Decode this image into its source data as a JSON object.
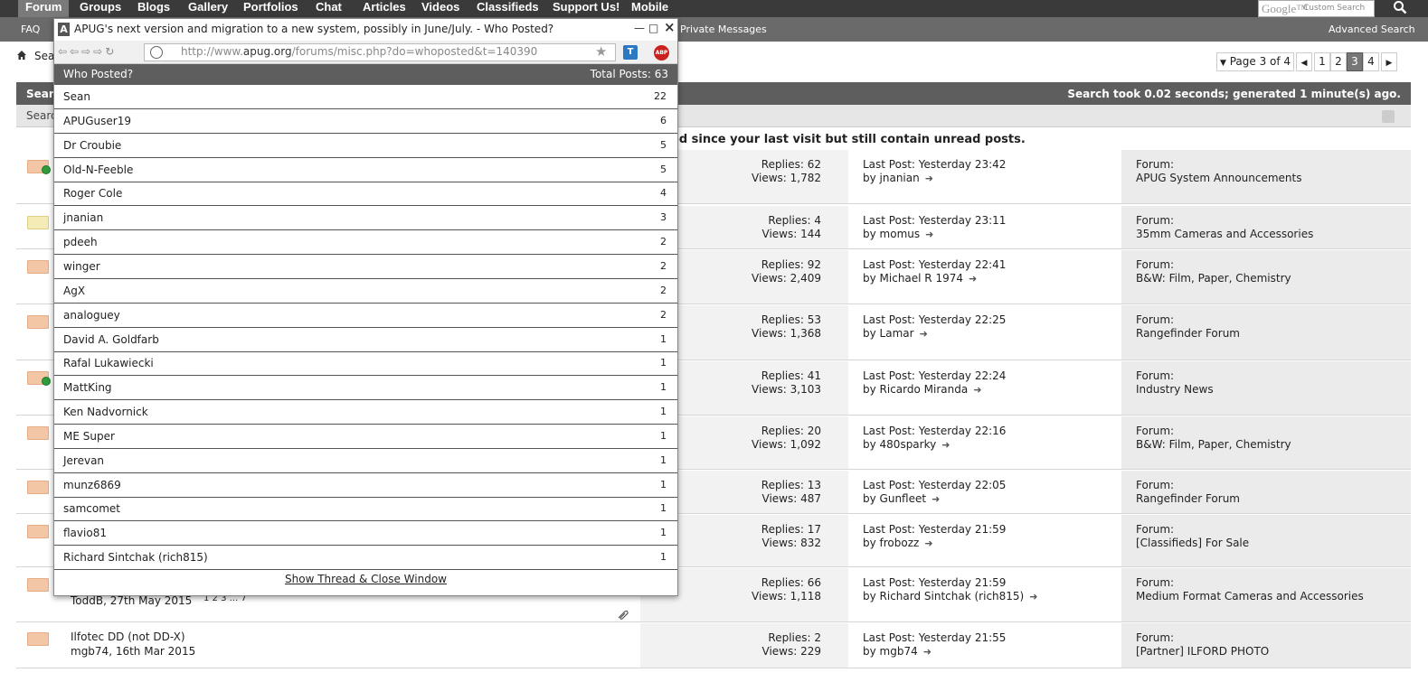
{
  "nav": {
    "items": [
      "Forum",
      "Groups",
      "Blogs",
      "Gallery",
      "Portfolios",
      "Chat",
      "Articles",
      "Videos",
      "Classifieds",
      "Support Us!",
      "Mobile"
    ],
    "search_brand": "Google™",
    "search_placeholder": "Custom Search"
  },
  "subnav": {
    "faq": "FAQ",
    "private_messages": "Private Messages",
    "advanced_search": "Advanced Search"
  },
  "breadcrumb": {
    "text": "Sea"
  },
  "pager": {
    "label": "Page 3 of 4",
    "pages": [
      "1",
      "2",
      "3",
      "4"
    ],
    "current": "3"
  },
  "results": {
    "left": "Searc",
    "right": "Search took 0.02 seconds; generated 1 minute(s) ago.",
    "filter": "Searc",
    "notice": "ed since your last visit but still contain unread posts."
  },
  "threads": [
    {
      "replies": "Replies: 62",
      "views": "Views: 1,782",
      "last": "Last Post: Yesterday 23:42",
      "by": "by jnanian",
      "forum_label": "Forum:",
      "forum": "APUG System Announcements",
      "icon": "unread",
      "go": true
    },
    {
      "replies": "Replies: 4",
      "views": "Views: 144",
      "last": "Last Post: Yesterday 23:11",
      "by": "by momus",
      "forum_label": "Forum:",
      "forum": "35mm Cameras and Accessories",
      "icon": "read",
      "go": false
    },
    {
      "replies": "Replies: 92",
      "views": "Views: 2,409",
      "last": "Last Post: Yesterday 22:41",
      "by": "by Michael R 1974",
      "forum_label": "Forum:",
      "forum": "B&W: Film, Paper, Chemistry",
      "icon": "unread",
      "go": false
    },
    {
      "replies": "Replies: 53",
      "views": "Views: 1,368",
      "last": "Last Post: Yesterday 22:25",
      "by": "by Lamar",
      "forum_label": "Forum:",
      "forum": "Rangefinder Forum",
      "icon": "unread",
      "go": false
    },
    {
      "replies": "Replies: 41",
      "views": "Views: 3,103",
      "last": "Last Post: Yesterday 22:24",
      "by": "by Ricardo Miranda",
      "forum_label": "Forum:",
      "forum": "Industry News",
      "icon": "unread",
      "go": true
    },
    {
      "replies": "Replies: 20",
      "views": "Views: 1,092",
      "last": "Last Post: Yesterday 22:16",
      "by": "by 480sparky",
      "forum_label": "Forum:",
      "forum": "B&W: Film, Paper, Chemistry",
      "icon": "unread",
      "go": false
    },
    {
      "replies": "Replies: 13",
      "views": "Views: 487",
      "last": "Last Post: Yesterday 22:05",
      "by": "by Gunfleet",
      "forum_label": "Forum:",
      "forum": "Rangefinder Forum",
      "icon": "unread",
      "go": false
    },
    {
      "replies": "Replies: 17",
      "views": "Views: 832",
      "last": "Last Post: Yesterday 21:59",
      "by": "by frobozz",
      "forum_label": "Forum:",
      "forum": "[Classifieds] For Sale",
      "icon": "unread",
      "go": false
    },
    {
      "replies": "Replies: 66",
      "views": "Views: 1,118",
      "last": "Last Post: Yesterday 21:59",
      "by": "by Richard Sintchak (rich815)",
      "forum_label": "Forum:",
      "forum": "Medium Format Cameras and Accessories",
      "icon": "unread",
      "go": false,
      "meta": "ToddB, 27th May 2015",
      "pages": "1  2  3 ... 7"
    },
    {
      "replies": "Replies: 2",
      "views": "Views: 229",
      "last": "Last Post: Yesterday 21:55",
      "by": "by mgb74",
      "forum_label": "Forum:",
      "forum": "[Partner] ILFORD PHOTO",
      "icon": "unread",
      "go": false,
      "title": "Ilfotec DD (not DD-X)",
      "meta": "mgb74, 16th Mar 2015"
    }
  ],
  "popup": {
    "app_letter": "A",
    "title": "APUG's next version and migration to a new system, possibly in June/July. - Who Posted?",
    "url_prefix": "http://www.",
    "url_host": "apug.org",
    "url_rest": "/forums/misc.php?do=whoposted&t=140390",
    "t_badge": "T",
    "abp_badge": "ABP",
    "header_left": "Who Posted?",
    "header_right": "Total Posts: 63",
    "posters": [
      {
        "name": "Sean",
        "count": "22"
      },
      {
        "name": "APUGuser19",
        "count": "6"
      },
      {
        "name": "Dr Croubie",
        "count": "5"
      },
      {
        "name": "Old-N-Feeble",
        "count": "5"
      },
      {
        "name": "Roger Cole",
        "count": "4"
      },
      {
        "name": "jnanian",
        "count": "3"
      },
      {
        "name": "pdeeh",
        "count": "2"
      },
      {
        "name": "winger",
        "count": "2"
      },
      {
        "name": "AgX",
        "count": "2"
      },
      {
        "name": "analoguey",
        "count": "2"
      },
      {
        "name": "David A. Goldfarb",
        "count": "1"
      },
      {
        "name": "Rafal Lukawiecki",
        "count": "1"
      },
      {
        "name": "MattKing",
        "count": "1"
      },
      {
        "name": "Ken Nadvornick",
        "count": "1"
      },
      {
        "name": "ME Super",
        "count": "1"
      },
      {
        "name": "Jerevan",
        "count": "1"
      },
      {
        "name": "munz6869",
        "count": "1"
      },
      {
        "name": "samcomet",
        "count": "1"
      },
      {
        "name": "flavio81",
        "count": "1"
      },
      {
        "name": "Richard Sintchak (rich815)",
        "count": "1"
      }
    ],
    "close_link": "Show Thread & Close Window"
  }
}
